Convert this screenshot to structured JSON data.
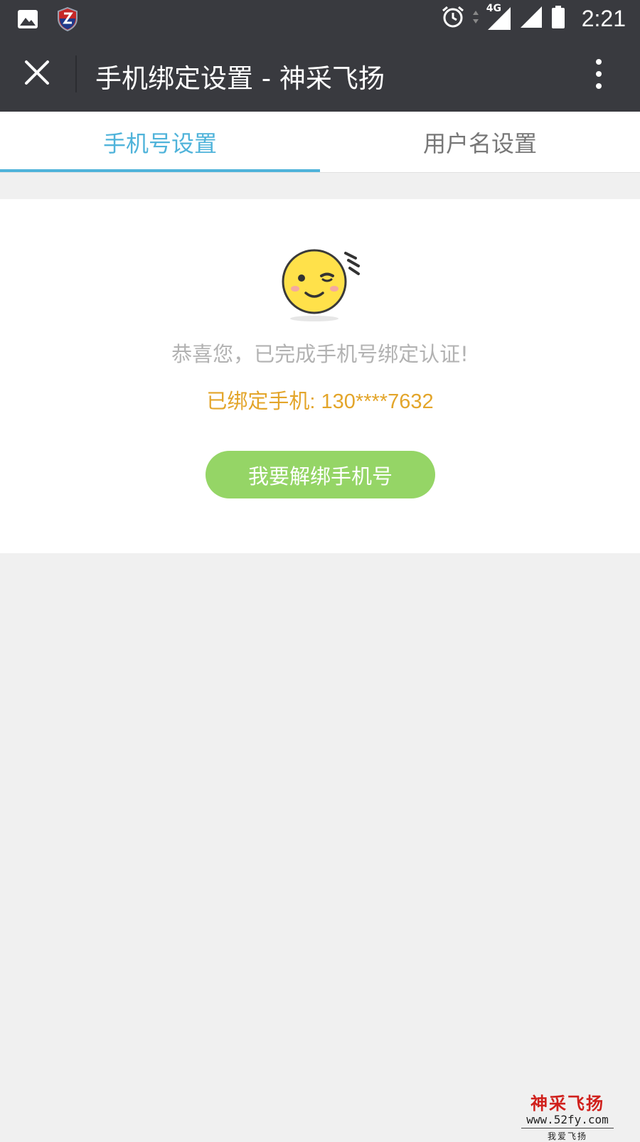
{
  "status_bar": {
    "time": "2:21",
    "network": "4G",
    "icons": [
      "gallery-icon",
      "shield-z-icon",
      "alarm-icon",
      "data-arrows-icon",
      "signal-icon",
      "signal-icon",
      "battery-icon"
    ]
  },
  "nav": {
    "title": "手机绑定设置 - 神采飞扬",
    "close_icon": "close-icon",
    "more_icon": "more-vertical-icon"
  },
  "tabs": [
    {
      "label": "手机号设置",
      "active": true
    },
    {
      "label": "用户名设置",
      "active": false
    }
  ],
  "content": {
    "emoji_icon": "wink-smiley-icon",
    "congrats_text": "恭喜您，已完成手机号绑定认证!",
    "bound_label": "已绑定手机",
    "bound_sep": ": ",
    "bound_phone": "130****7632",
    "unbind_button": "我要解绑手机号"
  },
  "watermark": {
    "title": "神采飞扬",
    "url": "www.52fy.com",
    "subtitle": "我爱飞扬"
  },
  "colors": {
    "header_bg": "#393a3f",
    "tab_active": "#4fb3da",
    "bound_text": "#e3a52a",
    "button_bg": "#95d566",
    "page_bg": "#f0f0f0"
  }
}
